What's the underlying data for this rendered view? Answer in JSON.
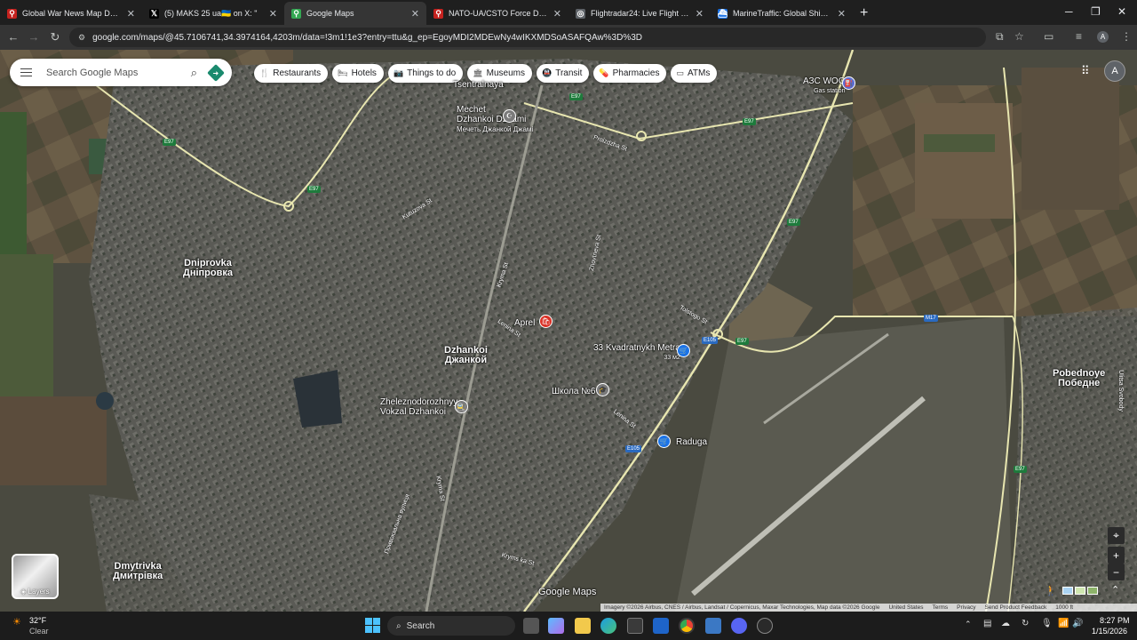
{
  "tabs": [
    {
      "title": "Global War News Map Day 1425",
      "favicon_color": "#c5221f",
      "favicon_glyph": "map-pin-icon"
    },
    {
      "title": "(5) MAKS 25 ua🇺🇦 on X: \"",
      "favicon_color": "#000000",
      "favicon_glyph": "x-logo-icon"
    },
    {
      "title": "Google Maps",
      "favicon_color": "#34a853",
      "favicon_glyph": "map-pin-icon",
      "active": true
    },
    {
      "title": "NATO-UA/CSTO Force Disposition",
      "favicon_color": "#c5221f",
      "favicon_glyph": "map-pin-icon"
    },
    {
      "title": "Flightradar24: Live Flight Tracker",
      "favicon_color": "#5f6368",
      "favicon_glyph": "radar-icon"
    },
    {
      "title": "MarineTraffic: Global Ship Tracking",
      "favicon_color": "#1a73e8",
      "favicon_glyph": "ship-icon"
    }
  ],
  "address": {
    "url": "google.com/maps/@45.7106741,34.3974164,4203m/data=!3m1!1e3?entry=ttu&g_ep=EgoyMDI2MDEwNy4wIKXMDSoASAFQAw%3D%3D"
  },
  "search": {
    "placeholder": "Search Google Maps"
  },
  "chips": [
    {
      "label": "Restaurants",
      "icon": "fork-knife-icon"
    },
    {
      "label": "Hotels",
      "icon": "bed-icon"
    },
    {
      "label": "Things to do",
      "icon": "camera-icon"
    },
    {
      "label": "Museums",
      "icon": "museum-icon"
    },
    {
      "label": "Transit",
      "icon": "transit-icon"
    },
    {
      "label": "Pharmacies",
      "icon": "pharmacy-icon"
    },
    {
      "label": "ATMs",
      "icon": "atm-icon"
    }
  ],
  "places": {
    "mechet1": "Mechet",
    "mechet2": "Dzhankoi Dzhami",
    "mechet3": "Мечеть Джанкой Джамі",
    "azs1": "АЗС WOG",
    "azs2": "Gas station",
    "dniprovka1": "Dniprovka",
    "dniprovka2": "Дніпровка",
    "dzhankoi1": "Dzhankoi",
    "dzhankoi2": "Джанкой",
    "aprel": "Aprel",
    "kv1": "33 Kvadratnykh Metra",
    "kv2": "33 м2",
    "school": "Школа №6",
    "vokzal1": "Zheleznodorozhnyy",
    "vokzal2": "Vokzal Dzhankoi",
    "raduga": "Raduga",
    "pobednoye1": "Pobednoye",
    "pobednoye2": "Победне",
    "dmytrivka1": "Dmytrivka",
    "dmytrivka2": "Дмитрівка",
    "tsentr": "Tsentralnaya"
  },
  "roads": {
    "kutuzova": "Kutuzova St",
    "kryma": "Kryma St",
    "lenina": "Lenina St",
    "lenina2": "Lenina St",
    "tolstogo": "Tolstogo St",
    "proizdzha": "Proizdzha St",
    "zhovtneva": "Zhovtneva St",
    "kryms2": "Kryma St",
    "kryms3": "Kryms ka St",
    "privokz": "Привокзальна вулиця",
    "ulsvobody": "Ulitsa Svobody"
  },
  "shields": [
    "E97",
    "E97",
    "E97",
    "E97",
    "E97",
    "E97",
    "E105",
    "E105",
    "E97",
    "M17"
  ],
  "branding": "Google Maps",
  "layers": {
    "label": "Layers"
  },
  "attribution": {
    "imagery": "Imagery ©2026 Airbus, CNES / Airbus, Landsat / Copernicus, Maxar Technologies, Map data ©2026 Google",
    "region": "United States",
    "terms": "Terms",
    "privacy": "Privacy",
    "feedback": "Send Product Feedback",
    "scale": "1000 ft"
  },
  "profile_initial": "A",
  "taskbar": {
    "weather_temp": "32°F",
    "weather_desc": "Clear",
    "search": "Search",
    "time": "8:27 PM",
    "date": "1/15/2026"
  },
  "colors": {
    "accent_blue": "#1a73e8",
    "poi_red": "#d93025",
    "poi_gray": "#7b7b7b",
    "poi_blue": "#1a73e8"
  }
}
